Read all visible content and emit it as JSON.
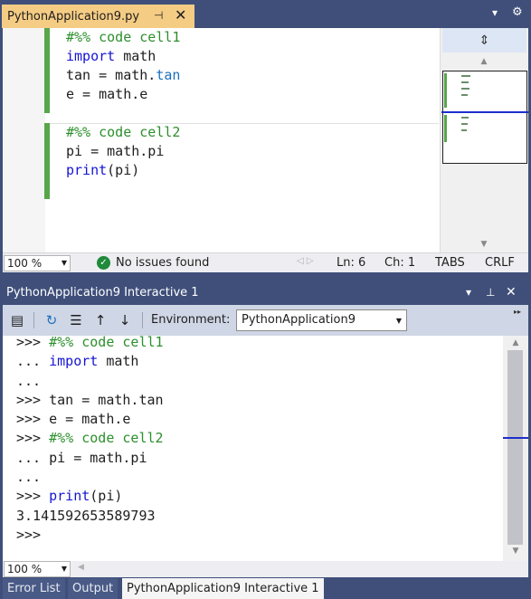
{
  "editor_tab": {
    "title": "PythonApplication9.py",
    "pin": "⊣",
    "close": "✕"
  },
  "top_strip": {
    "dropdown": "▾",
    "gear": "⚙"
  },
  "editor": {
    "lines": [
      [
        {
          "t": "#%% code cell1",
          "c": "cm"
        }
      ],
      [
        {
          "t": "import",
          "c": "kw"
        },
        {
          "t": " math",
          "c": ""
        }
      ],
      [
        {
          "t": "tan = math.",
          "c": ""
        },
        {
          "t": "tan",
          "c": "fn"
        }
      ],
      [
        {
          "t": "e = math.e",
          "c": ""
        }
      ],
      [
        {
          "t": "",
          "c": ""
        }
      ],
      [
        {
          "t": "#%% code cell2",
          "c": "cm"
        }
      ],
      [
        {
          "t": "pi = math.pi",
          "c": ""
        }
      ],
      [
        {
          "t": "print",
          "c": "kw"
        },
        {
          "t": "(pi)",
          "c": ""
        }
      ]
    ]
  },
  "status_bar": {
    "zoom": "100 %",
    "issues": "No issues found",
    "line": "Ln: 6",
    "col": "Ch: 1",
    "indent": "TABS",
    "eol": "CRLF"
  },
  "interactive": {
    "title": "PythonApplication9 Interactive 1",
    "environment_label": "Environment:",
    "environment_value": "PythonApplication9",
    "zoom": "100 %",
    "lines": [
      [
        {
          "t": ">>> ",
          "c": ""
        },
        {
          "t": "#%% code cell1",
          "c": "cm"
        }
      ],
      [
        {
          "t": "... ",
          "c": ""
        },
        {
          "t": "import",
          "c": "kw"
        },
        {
          "t": " math",
          "c": ""
        }
      ],
      [
        {
          "t": "...",
          "c": ""
        }
      ],
      [
        {
          "t": ">>> tan = math.tan",
          "c": ""
        }
      ],
      [
        {
          "t": ">>> e = math.e",
          "c": ""
        }
      ],
      [
        {
          "t": ">>> ",
          "c": ""
        },
        {
          "t": "#%% code cell2",
          "c": "cm"
        }
      ],
      [
        {
          "t": "... pi = math.pi",
          "c": ""
        }
      ],
      [
        {
          "t": "...",
          "c": ""
        }
      ],
      [
        {
          "t": ">>> ",
          "c": ""
        },
        {
          "t": "print",
          "c": "kw"
        },
        {
          "t": "(pi)",
          "c": ""
        }
      ],
      [
        {
          "t": "3.141592653589793",
          "c": ""
        }
      ],
      [
        {
          "t": ">>>",
          "c": ""
        }
      ]
    ]
  },
  "tool_tabs": [
    {
      "label": "Error List",
      "active": false
    },
    {
      "label": "Output",
      "active": false
    },
    {
      "label": "PythonApplication9 Interactive 1",
      "active": true
    }
  ],
  "colors": {
    "comment": "#2c8f2c",
    "keyword": "#1515d2",
    "accent_tab": "#f5cc84",
    "chrome": "#3f4f7a"
  }
}
